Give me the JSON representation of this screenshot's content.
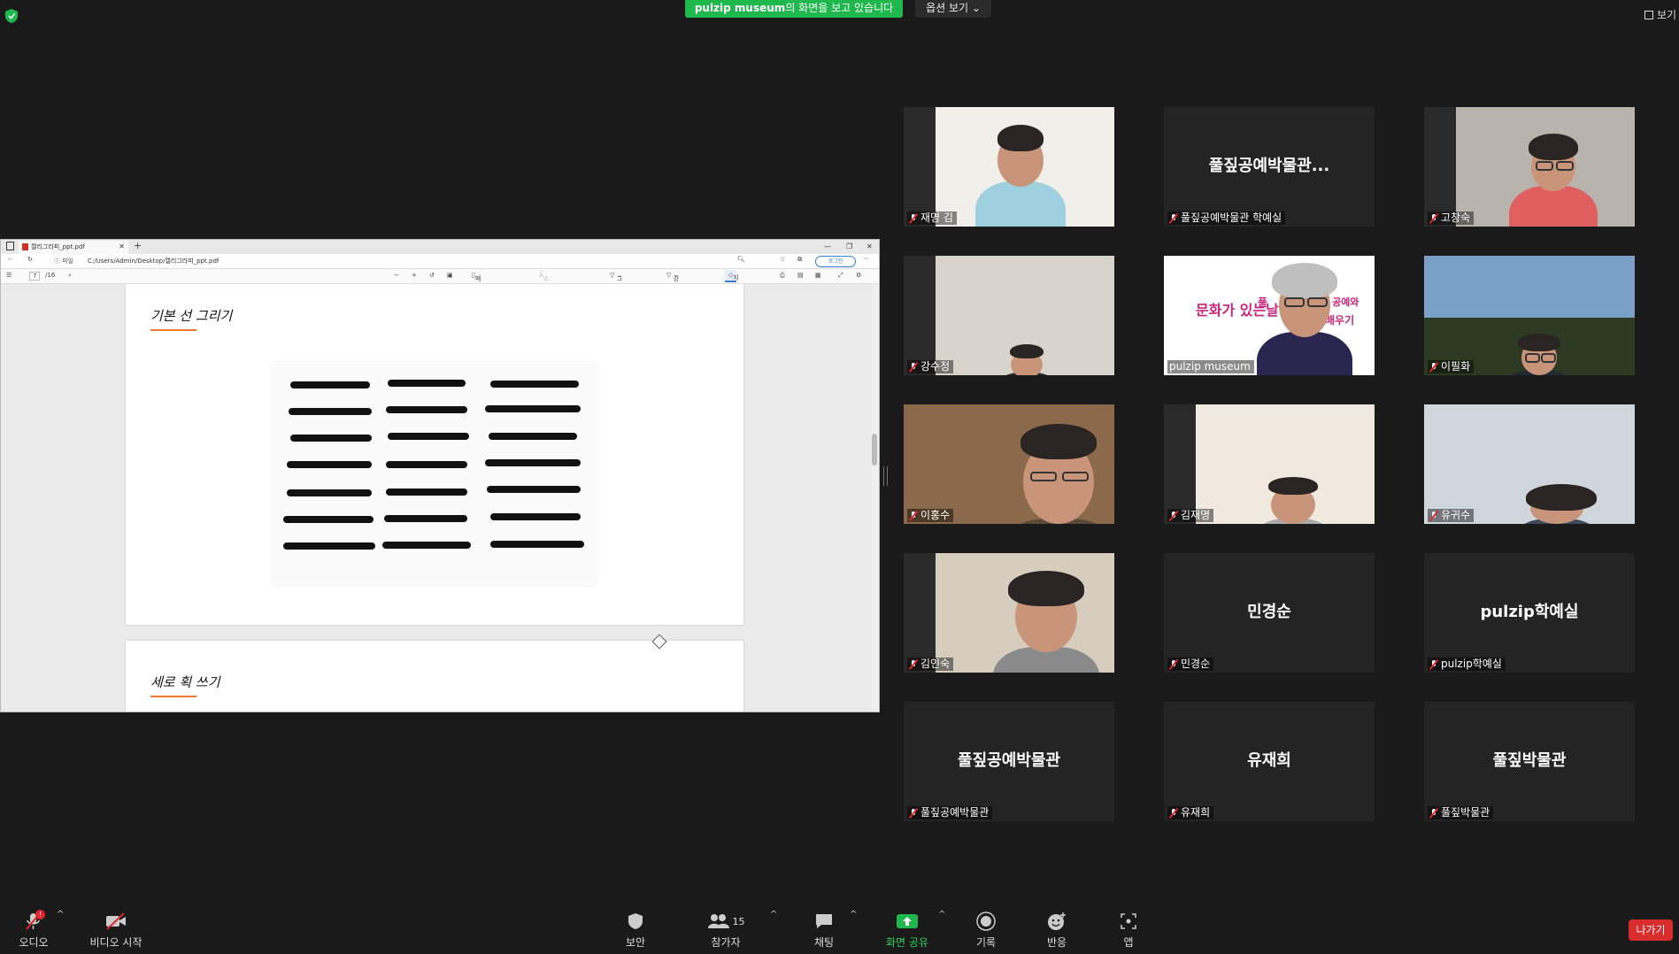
{
  "top": {
    "banner_host": "pulzip  museum",
    "banner_suffix": "의 화면을 보고 있습니다",
    "options_label": "옵션 보기 ⌄",
    "view_label": "보기"
  },
  "pdf": {
    "tab_title": "캘리그라피_ppt.pdf",
    "file_label": "파일",
    "url": "C:/Users/Admin/Desktop/캘리그라피_ppt.pdf",
    "login_label": "로그인",
    "page_current": "7",
    "page_total": "/16",
    "tool_page_view": "페이지 보기",
    "tool_read_aloud": "소리내어 읽기",
    "tool_draw": "그리기",
    "tool_highlight": "강조 표시",
    "tool_erase": "지우기",
    "page1_title": "기본 선 그리기",
    "page2_title": "세로 획 쓰기"
  },
  "participants": [
    {
      "name": "재명 김",
      "display": "",
      "muted": true,
      "video": true
    },
    {
      "name": "풀짚공예박물관 학예실",
      "display": "풀짚공예박물관...",
      "muted": true,
      "video": false
    },
    {
      "name": "고창숙",
      "display": "",
      "muted": true,
      "video": true
    },
    {
      "name": "강수정",
      "display": "",
      "muted": true,
      "video": true
    },
    {
      "name": "pulzip museum",
      "display": "",
      "muted": false,
      "video": true,
      "speaking": true
    },
    {
      "name": "이필화",
      "display": "",
      "muted": true,
      "video": true
    },
    {
      "name": "이홍수",
      "display": "",
      "muted": true,
      "video": true
    },
    {
      "name": "김재명",
      "display": "",
      "muted": true,
      "video": true
    },
    {
      "name": "유귀수",
      "display": "",
      "muted": true,
      "video": true
    },
    {
      "name": "김인숙",
      "display": "",
      "muted": true,
      "video": true
    },
    {
      "name": "민경순",
      "display": "민경순",
      "muted": true,
      "video": false
    },
    {
      "name": "pulzip학예실",
      "display": "pulzip학예실",
      "muted": true,
      "video": false
    },
    {
      "name": "풀짚공예박물관",
      "display": "풀짚공예박물관",
      "muted": true,
      "video": false
    },
    {
      "name": "유재희",
      "display": "유재희",
      "muted": true,
      "video": false
    },
    {
      "name": "풀짚박물관",
      "display": "풀짚박물관",
      "muted": true,
      "video": false
    }
  ],
  "slide_text": {
    "line1": "가 있는 날",
    "line2": "문화가 있는날",
    "line3": "풀",
    "line4": "들이 공예와",
    "line5": "배우기"
  },
  "toolbar": {
    "audio": "오디오",
    "audio_badge": "!",
    "video": "비디오 시작",
    "security": "보안",
    "participants": "참가자",
    "participants_count": "15",
    "chat": "채팅",
    "share": "화면 공유",
    "record": "기록",
    "reactions": "반응",
    "apps": "앱",
    "leave": "나가기"
  },
  "colors": {
    "share_green": "#1fb84d",
    "leave_red": "#d92d2d",
    "speaker_outline": "#d9e84a"
  }
}
